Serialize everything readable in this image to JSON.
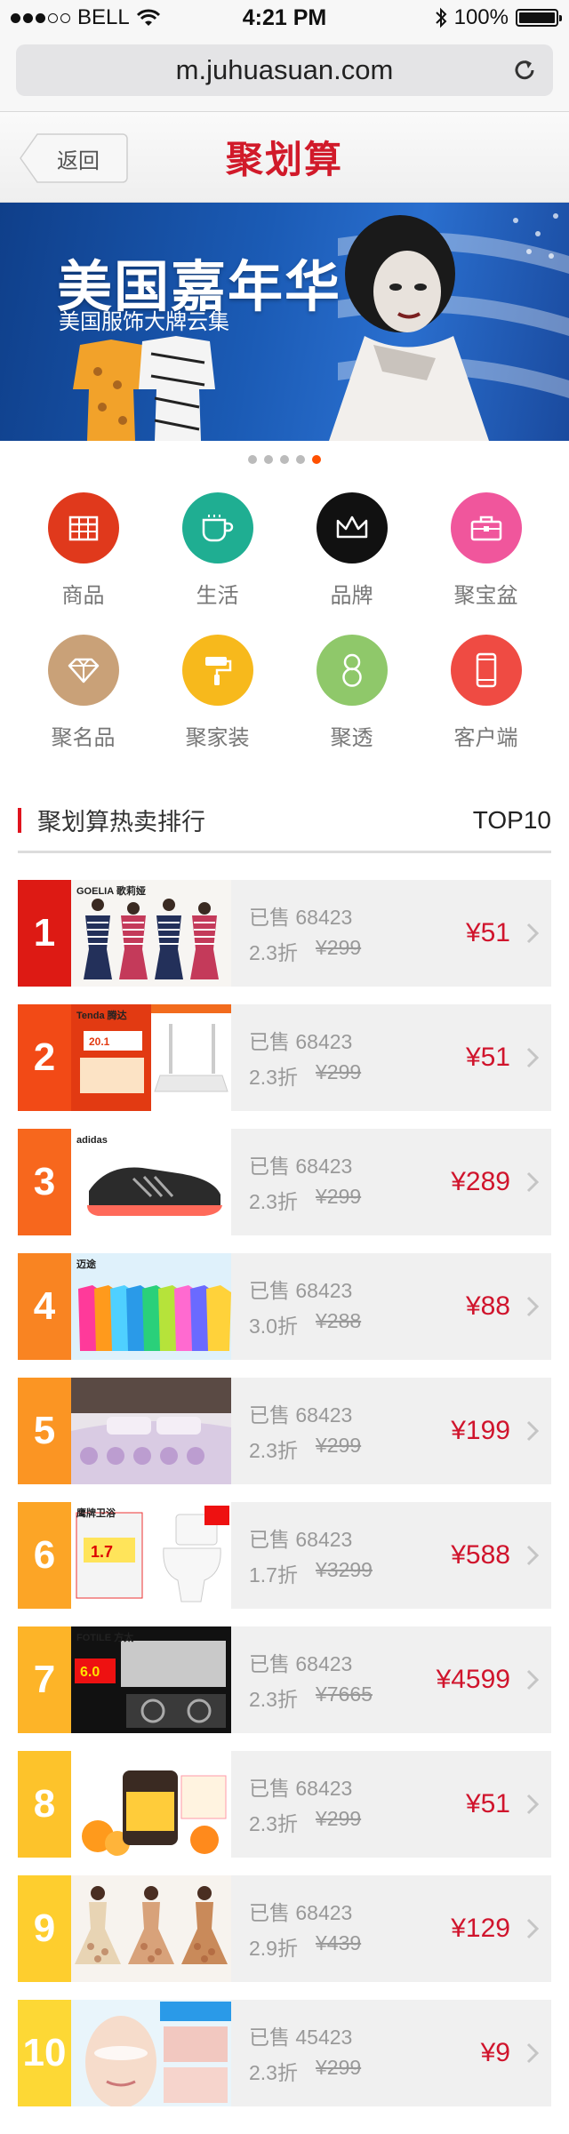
{
  "status_bar": {
    "carrier": "BELL",
    "time": "4:21 PM",
    "battery": "100%",
    "battery_level": 1.0
  },
  "browser": {
    "url": "m.juhuasuan.com"
  },
  "header": {
    "back_label": "返回",
    "logo": "聚划算"
  },
  "banner": {
    "title": "美国嘉年华",
    "subtitle": "美国服饰大牌云集",
    "dots": 5,
    "active_dot": 4
  },
  "categories": [
    {
      "label": "商品",
      "icon": "grid-calendar-icon",
      "color": "#e0391c"
    },
    {
      "label": "生活",
      "icon": "cup-icon",
      "color": "#1fae92"
    },
    {
      "label": "品牌",
      "icon": "crown-icon",
      "color": "#111111"
    },
    {
      "label": "聚宝盆",
      "icon": "briefcase-icon",
      "color": "#f0569c"
    },
    {
      "label": "聚名品",
      "icon": "diamond-icon",
      "color": "#c9a178"
    },
    {
      "label": "聚家装",
      "icon": "paint-roller-icon",
      "color": "#f7b91c"
    },
    {
      "label": "聚透",
      "icon": "number-8-icon",
      "color": "#8fc86a"
    },
    {
      "label": "客户端",
      "icon": "phone-icon",
      "color": "#ef4b43"
    }
  ],
  "ranking": {
    "title": "聚划算热卖排行",
    "badge": "TOP10",
    "items": [
      {
        "rank": "1",
        "sold_label": "已售",
        "sold": "68423",
        "discount": "2.3折",
        "original": "¥299",
        "price": "¥51",
        "rank_color": "#dd1a14",
        "thumb": "clothing",
        "brand": "GOELIA 歌莉娅"
      },
      {
        "rank": "2",
        "sold_label": "已售",
        "sold": "68423",
        "discount": "2.3折",
        "original": "¥299",
        "price": "¥51",
        "rank_color": "#f24a16",
        "thumb": "router",
        "brand": "Tenda 腾达"
      },
      {
        "rank": "3",
        "sold_label": "已售",
        "sold": "68423",
        "discount": "2.3折",
        "original": "¥299",
        "price": "¥289",
        "rank_color": "#f7671d",
        "thumb": "shoe",
        "brand": "adidas"
      },
      {
        "rank": "4",
        "sold_label": "已售",
        "sold": "68423",
        "discount": "3.0折",
        "original": "¥288",
        "price": "¥88",
        "rank_color": "#f98422",
        "thumb": "jackets",
        "brand": "迈途"
      },
      {
        "rank": "5",
        "sold_label": "已售",
        "sold": "68423",
        "discount": "2.3折",
        "original": "¥299",
        "price": "¥199",
        "rank_color": "#fb9523",
        "thumb": "bedding",
        "brand": ""
      },
      {
        "rank": "6",
        "sold_label": "已售",
        "sold": "68423",
        "discount": "1.7折",
        "original": "¥3299",
        "price": "¥588",
        "rank_color": "#fca526",
        "thumb": "toilet",
        "brand": "鹰牌卫浴"
      },
      {
        "rank": "7",
        "sold_label": "已售",
        "sold": "68423",
        "discount": "2.3折",
        "original": "¥7665",
        "price": "¥4599",
        "rank_color": "#fdb428",
        "thumb": "range-hood",
        "brand": "FOTILE 方太"
      },
      {
        "rank": "8",
        "sold_label": "已售",
        "sold": "68423",
        "discount": "2.3折",
        "original": "¥299",
        "price": "¥51",
        "rank_color": "#fdc32b",
        "thumb": "supplement",
        "brand": ""
      },
      {
        "rank": "9",
        "sold_label": "已售",
        "sold": "68423",
        "discount": "2.9折",
        "original": "¥439",
        "price": "¥129",
        "rank_color": "#fece2e",
        "thumb": "dresses",
        "brand": ""
      },
      {
        "rank": "10",
        "sold_label": "已售",
        "sold": "45423",
        "discount": "2.3折",
        "original": "¥299",
        "price": "¥9",
        "rank_color": "#fdd835",
        "thumb": "skincare",
        "brand": ""
      }
    ]
  }
}
